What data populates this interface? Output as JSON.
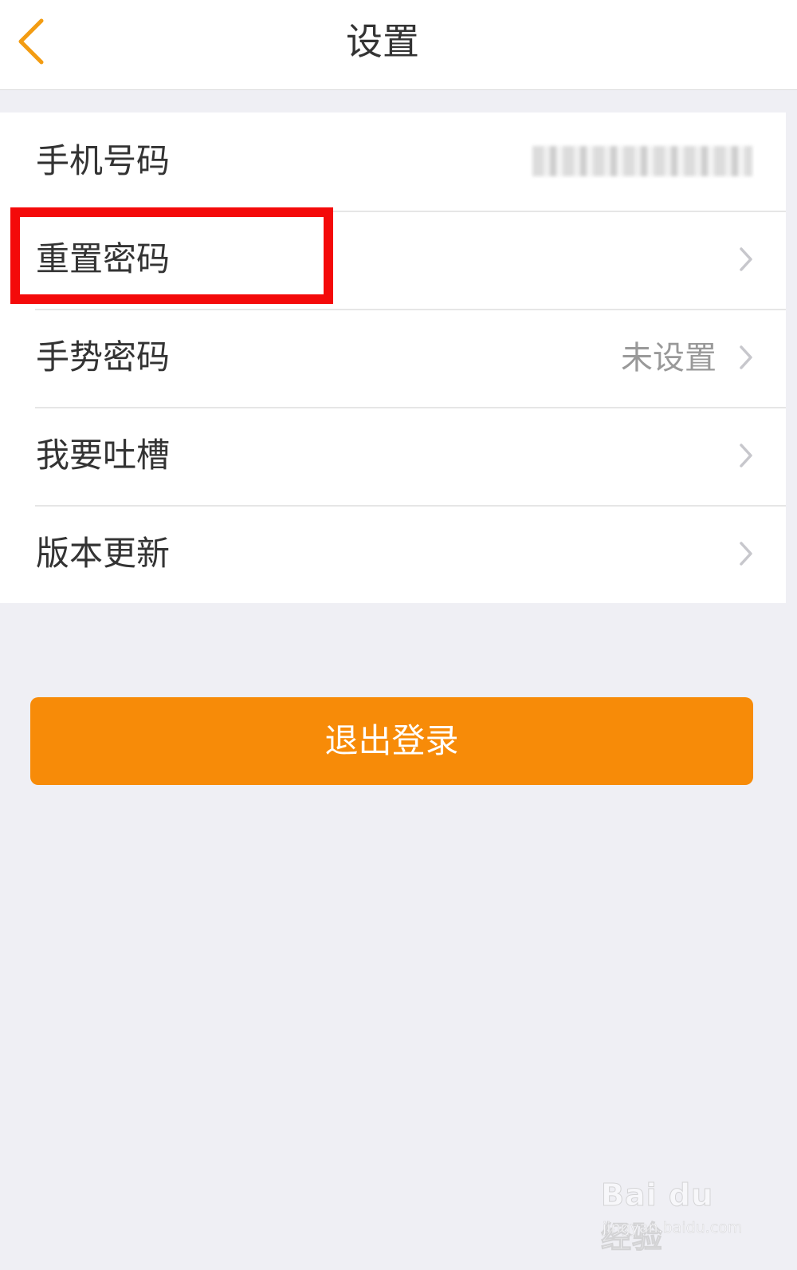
{
  "nav": {
    "title": "设置",
    "back_icon": "chevron-left-icon",
    "accent": "#f39c12"
  },
  "settings": [
    {
      "label": "手机号码",
      "value": "",
      "value_hidden": true,
      "arrow": false
    },
    {
      "label": "重置密码",
      "value": "",
      "arrow": true
    },
    {
      "label": "手势密码",
      "value": "未设置",
      "arrow": true
    },
    {
      "label": "我要吐槽",
      "value": "",
      "arrow": true
    },
    {
      "label": "版本更新",
      "value": "",
      "arrow": true
    }
  ],
  "highlighted_item": "重置密码",
  "highlight_color": "#f40a0a",
  "logout": {
    "label": "退出登录",
    "color": "#f78b08"
  },
  "watermark": {
    "logo": "Bai du 经验",
    "url": "jingyan.baidu.com"
  }
}
